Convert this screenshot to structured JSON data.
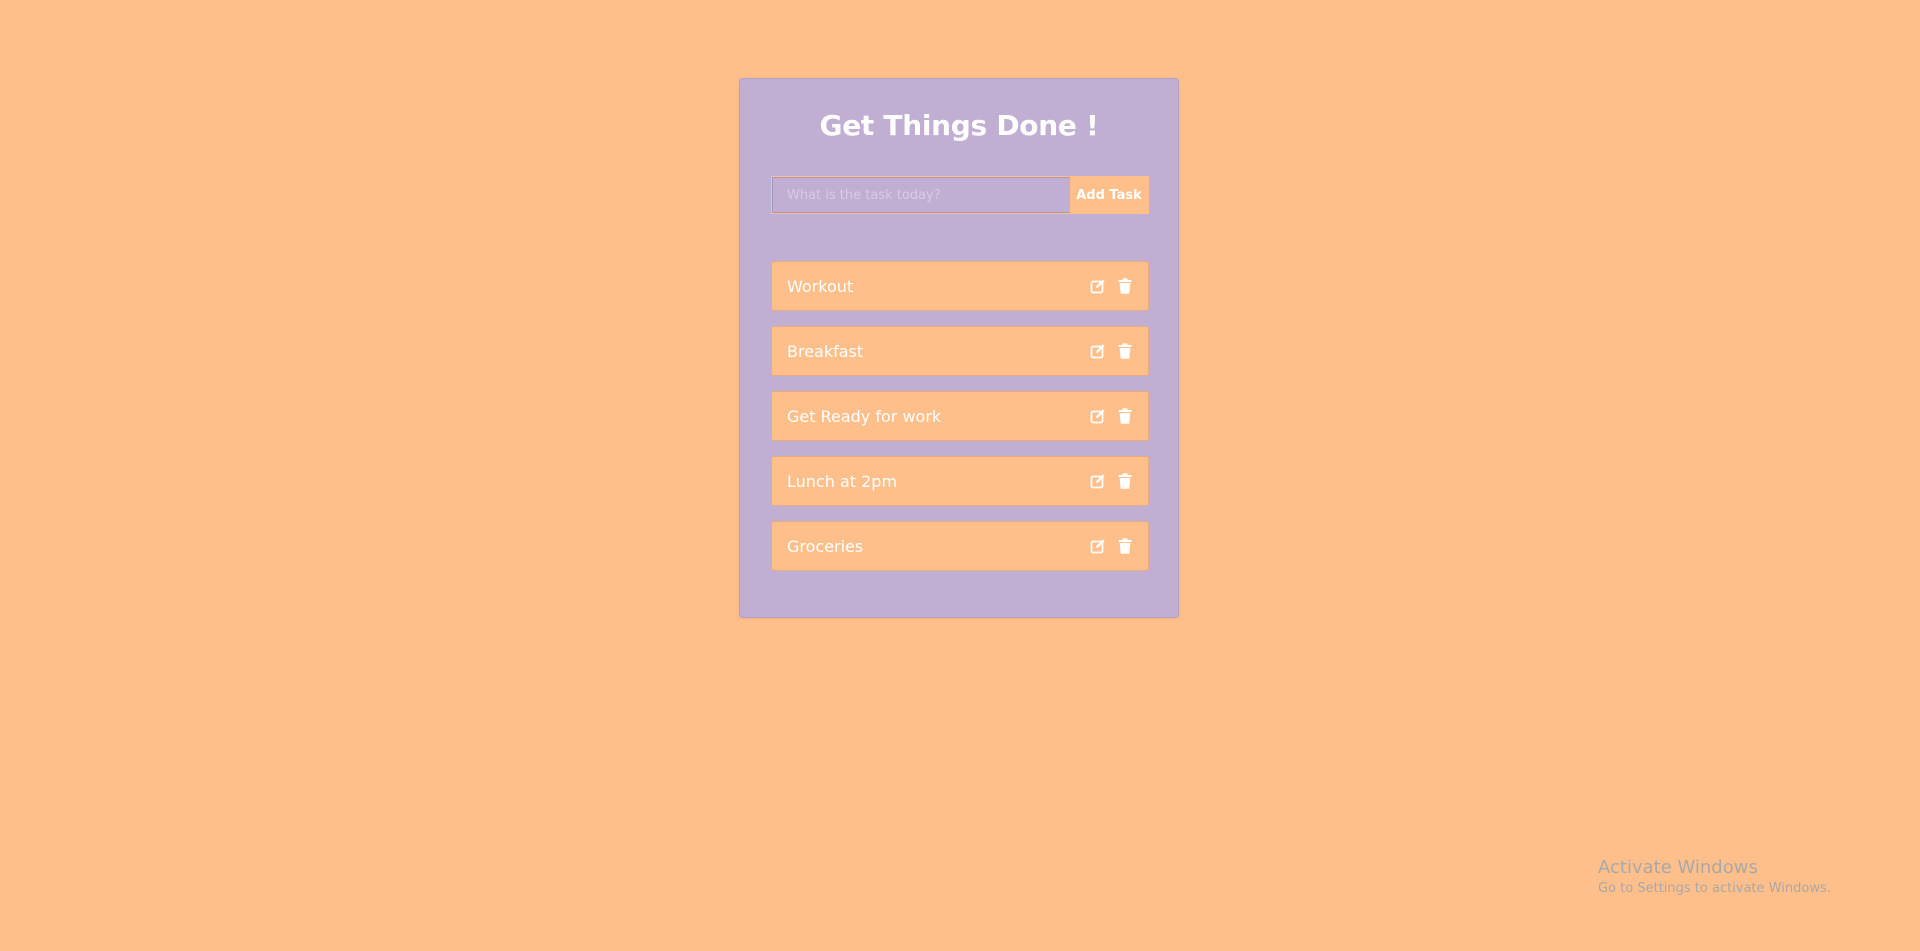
{
  "app": {
    "title": "Get Things Done !"
  },
  "form": {
    "placeholder": "What is the task today?",
    "value": "",
    "add_label": "Add Task"
  },
  "tasks": [
    {
      "label": "Workout"
    },
    {
      "label": "Breakfast"
    },
    {
      "label": "Get Ready for work"
    },
    {
      "label": "Lunch at 2pm"
    },
    {
      "label": "Groceries"
    }
  ],
  "icons": {
    "edit": "edit-icon",
    "delete": "trash-icon"
  },
  "colors": {
    "background": "#ffbf8b",
    "card": "#c1aed3",
    "accent": "#ffbf8b",
    "text": "#ffffff"
  },
  "watermark": {
    "title": "Activate Windows",
    "subtitle": "Go to Settings to activate Windows."
  }
}
